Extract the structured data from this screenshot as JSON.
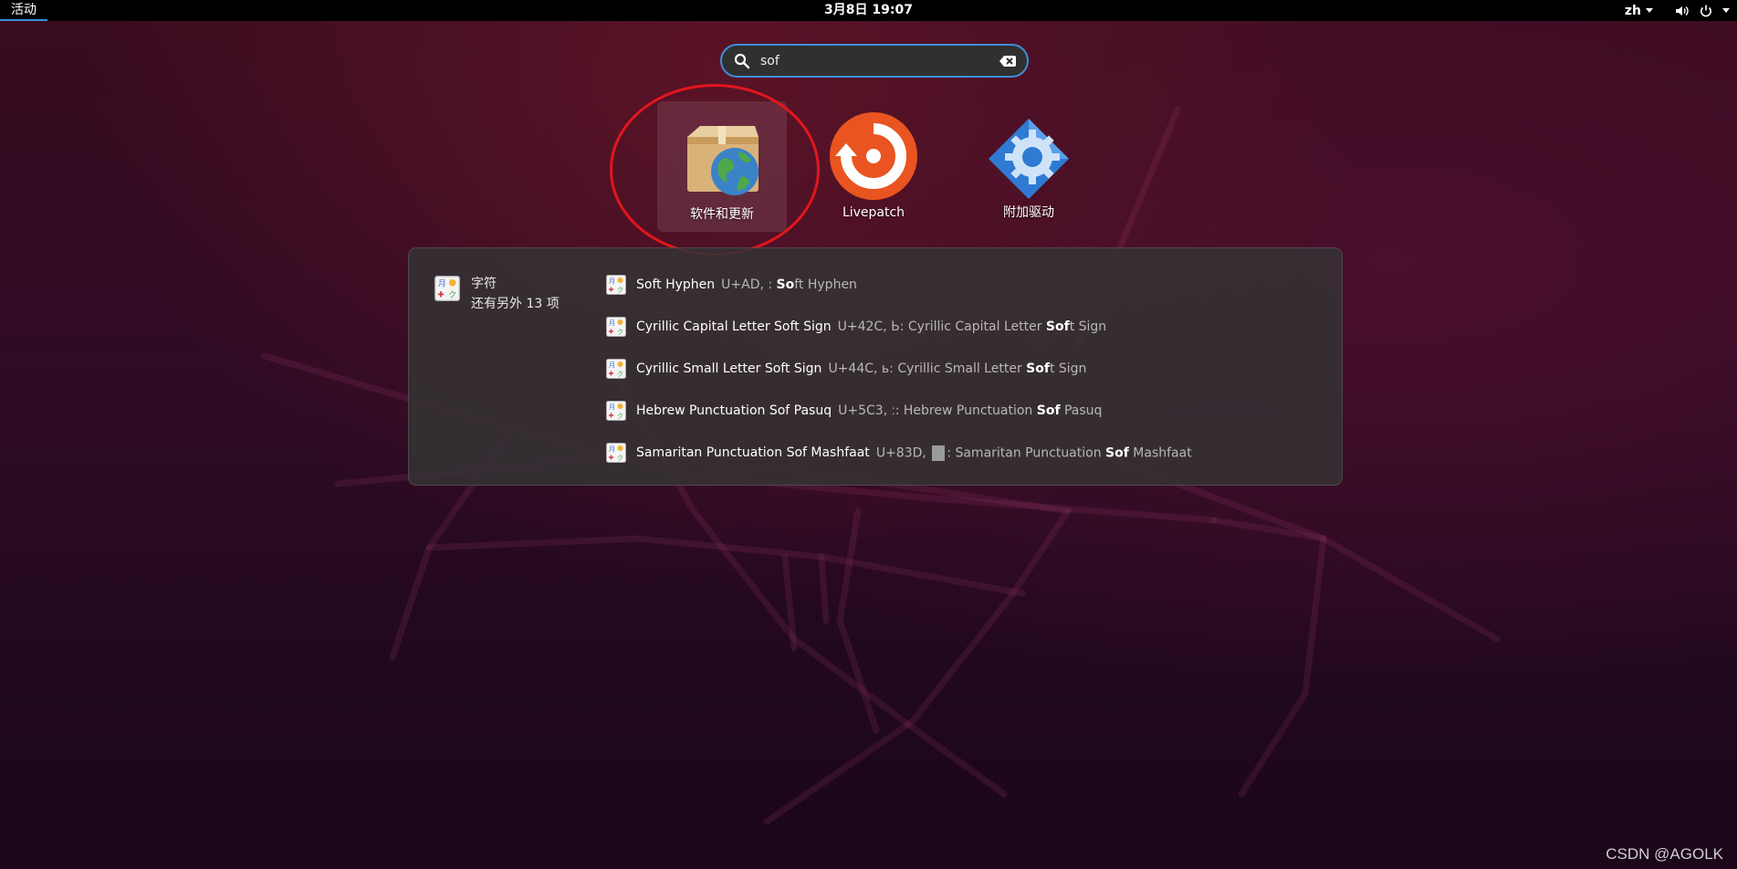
{
  "topbar": {
    "activities": "活动",
    "clock": "3月8日  19:07",
    "lang": "zh"
  },
  "search": {
    "value": "sof"
  },
  "apps": [
    {
      "label": "软件和更新",
      "icon": "software-updates-icon",
      "selected": true
    },
    {
      "label": "Livepatch",
      "icon": "livepatch-icon"
    },
    {
      "label": "附加驱动",
      "icon": "additional-drivers-icon"
    }
  ],
  "results": {
    "provider": {
      "name": "字符",
      "more": "还有另外 13 项",
      "icon": "charmap-icon"
    },
    "items": [
      {
        "title": "Soft Hyphen",
        "desc_pre": "U+AD, : ",
        "match": "So",
        "desc_post": "ft Hyphen"
      },
      {
        "title": "Cyrillic Capital Letter Soft Sign",
        "desc_pre": "U+42C, Ь: Cyrillic Capital Letter ",
        "match": "Sof",
        "desc_post": "t Sign"
      },
      {
        "title": "Cyrillic Small Letter Soft Sign",
        "desc_pre": "U+44C, ь: Cyrillic Small Letter ",
        "match": "Sof",
        "desc_post": "t Sign"
      },
      {
        "title": "Hebrew Punctuation Sof Pasuq",
        "desc_pre": "U+5C3, ׃: Hebrew Punctuation ",
        "match": "Sof",
        "desc_post": " Pasuq"
      },
      {
        "title": "Samaritan Punctuation Sof Mashfaat",
        "desc_pre": "U+83D, ",
        "glyph_box": true,
        "desc_mid": ": Samaritan Punctuation ",
        "match": "Sof",
        "desc_post": " Mashfaat"
      }
    ]
  },
  "watermark": "CSDN @AGOLK",
  "colors": {
    "accent": "#3d8fd8",
    "annotation": "#e3161d"
  }
}
